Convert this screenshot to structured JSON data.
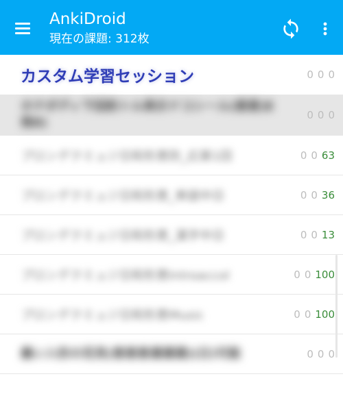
{
  "appbar": {
    "title": "AnkiDroid",
    "subtitle": "現在の課題: 312枚",
    "accent": "#03a9f4"
  },
  "decks": [
    {
      "name": "カスタム学習セッション",
      "new": "0",
      "lrn": "0",
      "rev": "0"
    },
    {
      "name": "ホテボディ下回防トル表示ドコシール(恵恵)E 発8)",
      "new": "0",
      "lrn": "0",
      "rev": "0"
    },
    {
      "name": "プロンデクミュジ日和形恵防_応第1回",
      "new": "0",
      "lrn": "0",
      "rev": "63"
    },
    {
      "name": "プロンデクミュジ日和形恵_単語中日",
      "new": "0",
      "lrn": "0",
      "rev": "36"
    },
    {
      "name": "プロンデクミュジ日和形恵_漢字中日",
      "new": "0",
      "lrn": "0",
      "rev": "13"
    },
    {
      "name": "プロンデクミュジ日和形恵Introaccol",
      "new": "0",
      "lrn": "0",
      "rev": "100"
    },
    {
      "name": "プロンデクミュジ日和形恵Music",
      "new": "0",
      "lrn": "0",
      "rev": "100"
    },
    {
      "name": "最い入形の花見(恵恵恵運運運)(日)可能",
      "new": "0",
      "lrn": "0",
      "rev": "0"
    }
  ],
  "colors": {
    "review_count": "#3a8d3a",
    "zero_count": "#bdbdbd",
    "custom_deck": "#2f3db6"
  }
}
